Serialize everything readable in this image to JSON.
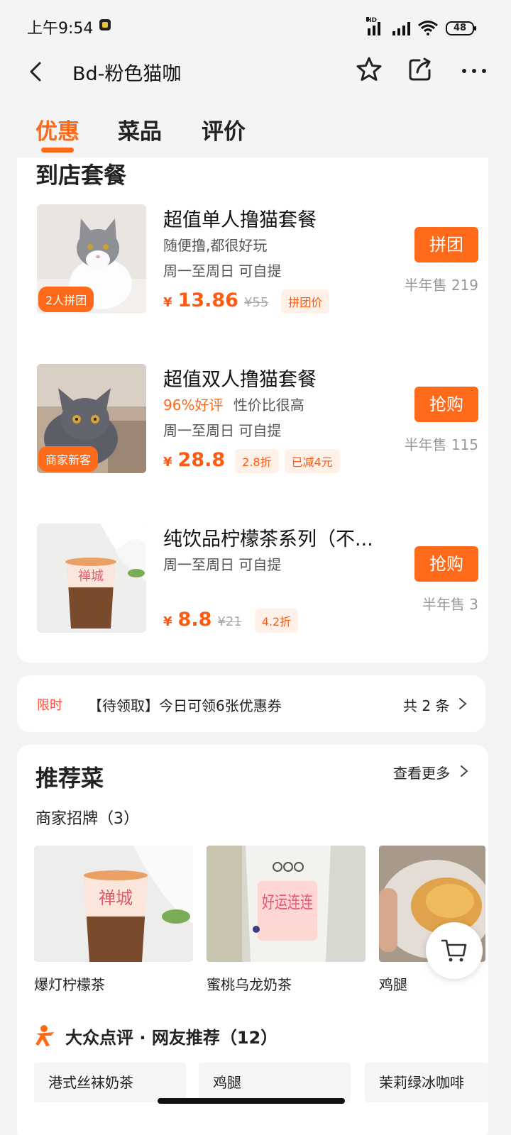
{
  "status_bar": {
    "time": "上午9:54",
    "network_label": "HD",
    "battery": "48"
  },
  "nav": {
    "title": "Bd-粉色猫咖"
  },
  "tabs": [
    {
      "label": "优惠"
    },
    {
      "label": "菜品"
    },
    {
      "label": "评价"
    }
  ],
  "packages": {
    "section_title": "到店套餐",
    "items": [
      {
        "title": "超值单人撸猫套餐",
        "desc": "随便撸,都很好玩",
        "availability": "周一至周日  可自提",
        "thumb_tag": "2人拼团",
        "currency": "¥",
        "price": "13.86",
        "original_price": "¥55",
        "tags": [
          "拼团价"
        ],
        "button": "拼团",
        "sold": "半年售 219"
      },
      {
        "title": "超值双人撸猫套餐",
        "rating": "96%好评",
        "desc": "性价比很高",
        "availability": "周一至周日  可自提",
        "thumb_tag": "商家新客",
        "currency": "¥",
        "price": "28.8",
        "tags": [
          "2.8折",
          "已减4元"
        ],
        "button": "抢购",
        "sold": "半年售 115"
      },
      {
        "title": "纯饮品柠檬茶系列（不...",
        "availability": "周一至周日  可自提",
        "currency": "¥",
        "price": "8.8",
        "original_price": "¥21",
        "tags": [
          "4.2折"
        ],
        "button": "抢购",
        "sold": "半年售 3",
        "cup_text": "禅城"
      }
    ]
  },
  "coupon": {
    "badge": "限时",
    "text": "【待领取】今日可领6张优惠券",
    "count": "共 2 条"
  },
  "recommended": {
    "title": "推荐菜",
    "more": "查看更多",
    "subtitle": "商家招牌（3）",
    "dishes": [
      {
        "name": "爆灯柠檬茶",
        "cup_text": "禅城"
      },
      {
        "name": "蜜桃乌龙奶茶",
        "cup_text": "好运连连"
      },
      {
        "name": "鸡腿"
      }
    ],
    "dianping_label": "大众点评 · 网友推荐（12）",
    "chips": [
      "港式丝袜奶茶",
      "鸡腿",
      "茉莉绿冰咖啡"
    ]
  },
  "colors": {
    "accent": "#ff6a1a",
    "price": "#ff5a12",
    "limited": "#ff4a3a"
  }
}
